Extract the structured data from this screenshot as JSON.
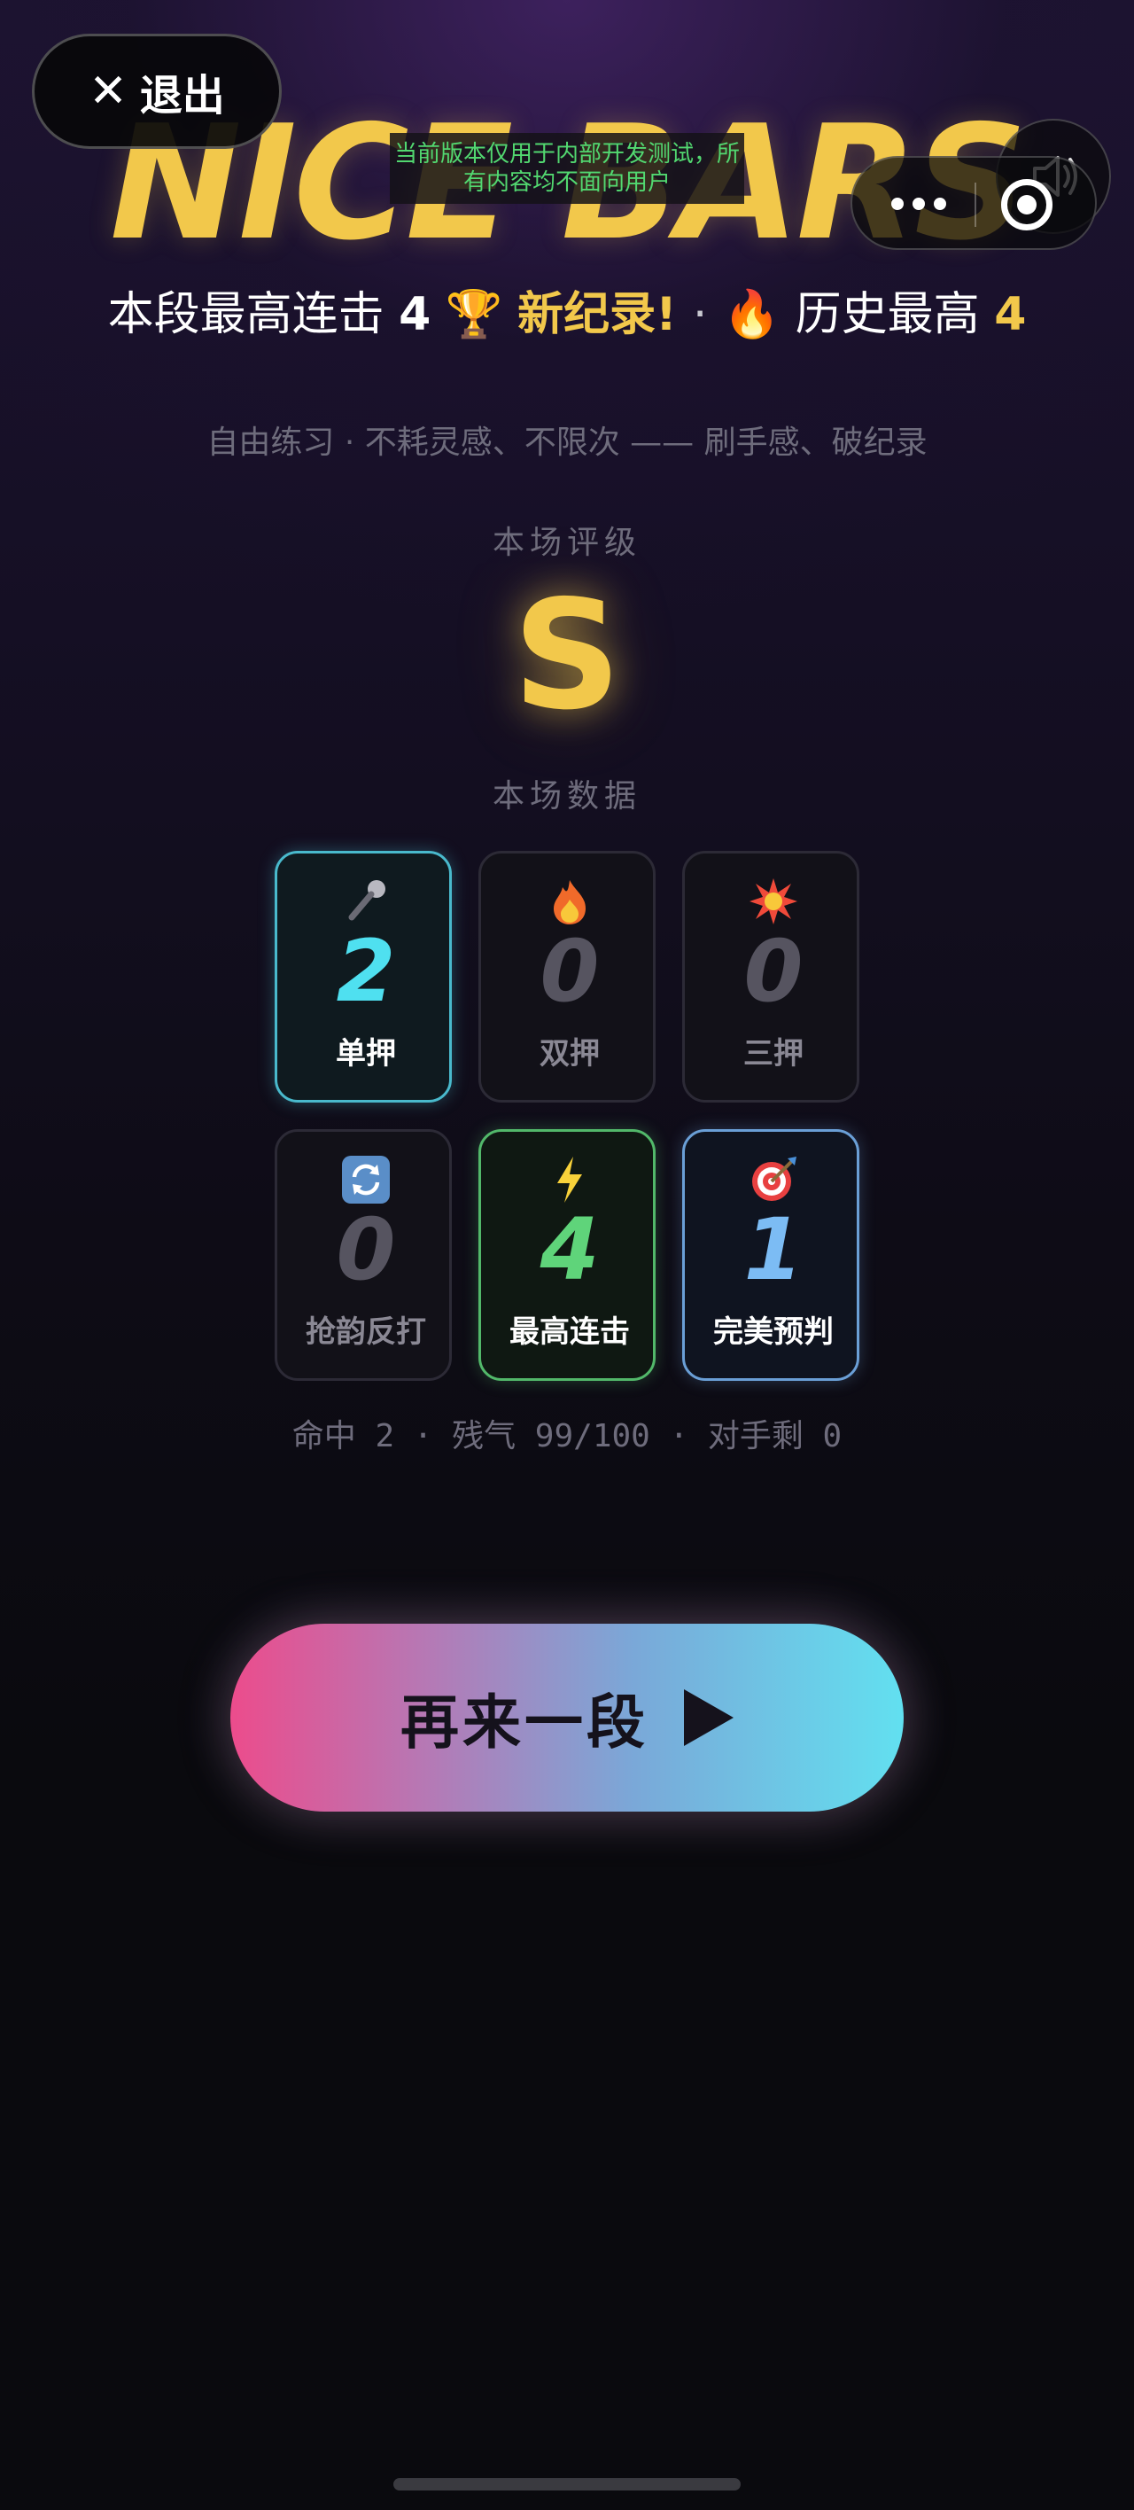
{
  "header": {
    "logo_text": "NICE BARS",
    "exit_label": "退出",
    "dev_notice": "当前版本仅用于内部开发测试，所有内容均不面向用户"
  },
  "record": {
    "prefix": "本段最高连击",
    "combo": "4",
    "new_record": "新纪录!",
    "history_label": "历史最高",
    "history_value": "4"
  },
  "subtitle": "自由练习 · 不耗灵感、不限次 —— 刷手感、破纪录",
  "rating": {
    "label": "本场评级",
    "grade": "S"
  },
  "stats_label": "本场数据",
  "stats": [
    {
      "label": "单押",
      "value": "2",
      "icon": "microphone-icon"
    },
    {
      "label": "双押",
      "value": "0",
      "icon": "fire-icon"
    },
    {
      "label": "三押",
      "value": "0",
      "icon": "explosion-icon"
    },
    {
      "label": "抢韵反打",
      "value": "0",
      "icon": "repeat-icon"
    },
    {
      "label": "最高连击",
      "value": "4",
      "icon": "lightning-icon"
    },
    {
      "label": "完美预判",
      "value": "1",
      "icon": "bullseye-icon"
    }
  ],
  "summary": "命中 2 · 残气 99/100 · 对手剩 0",
  "again_button": "再来一段",
  "colors": {
    "gold": "#f2c84b",
    "cyan": "#4fe0f0",
    "green": "#5fd47a",
    "blue": "#7cbcf4",
    "pink": "#ec4c8c"
  }
}
